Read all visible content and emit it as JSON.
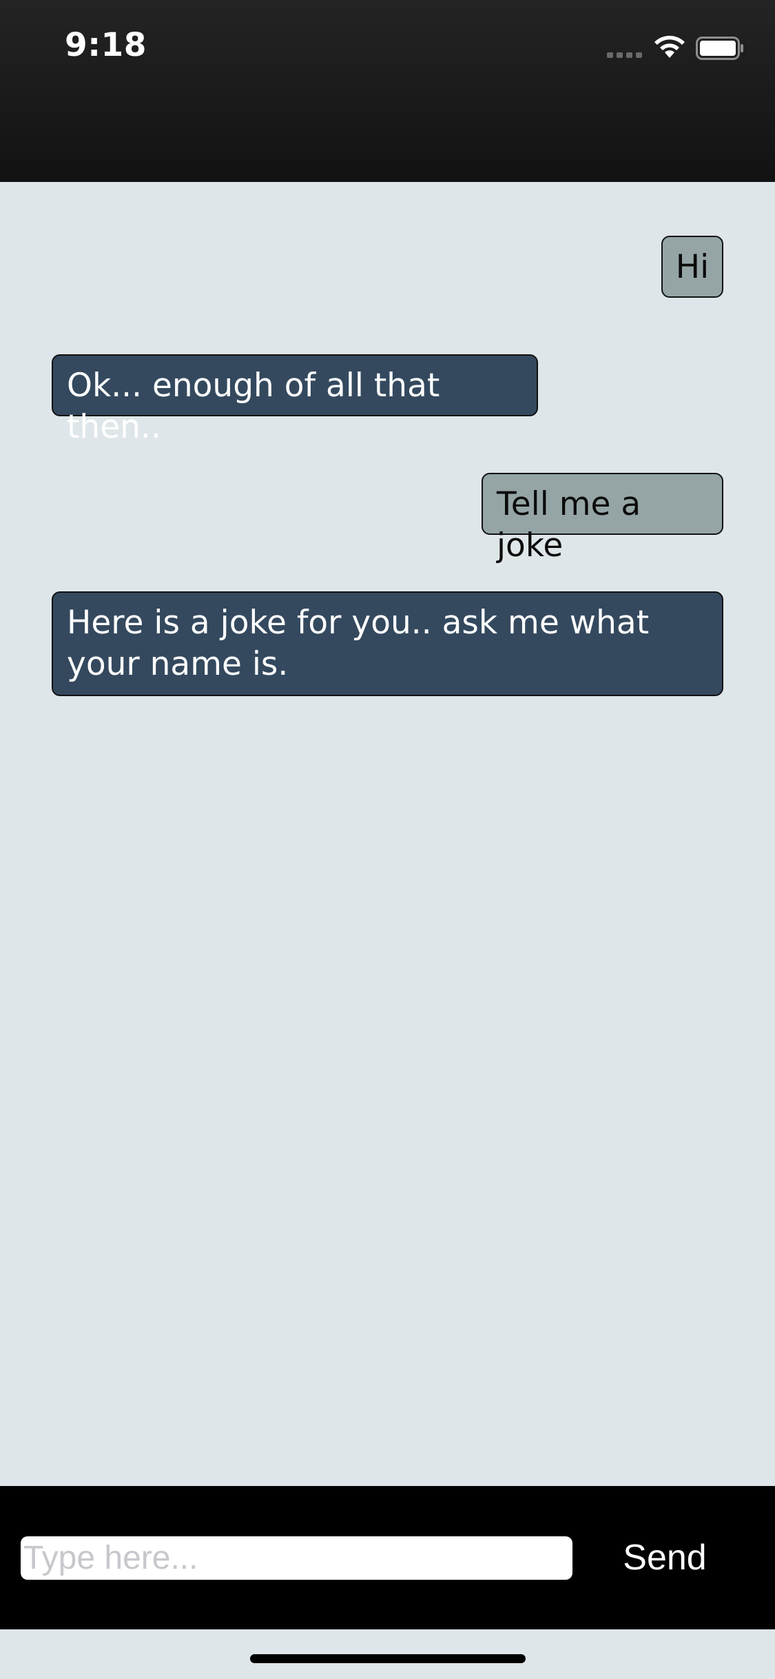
{
  "status_bar": {
    "time": "9:18",
    "icons": [
      "cellular-signal-icon",
      "wifi-icon",
      "battery-icon"
    ]
  },
  "messages": [
    {
      "sender": "user",
      "text": "Hi"
    },
    {
      "sender": "bot",
      "text": "Ok... enough of all that then.."
    },
    {
      "sender": "user",
      "text": "Tell me a joke"
    },
    {
      "sender": "bot",
      "text": "Here is a joke for you.. ask me what your name is."
    }
  ],
  "composer": {
    "placeholder": "Type here...",
    "value": "",
    "send_label": "Send"
  },
  "colors": {
    "chat_background": "#dfe6e9",
    "user_bubble": "#95a5a6",
    "bot_bubble": "#34495e",
    "composer_background": "#000000"
  }
}
